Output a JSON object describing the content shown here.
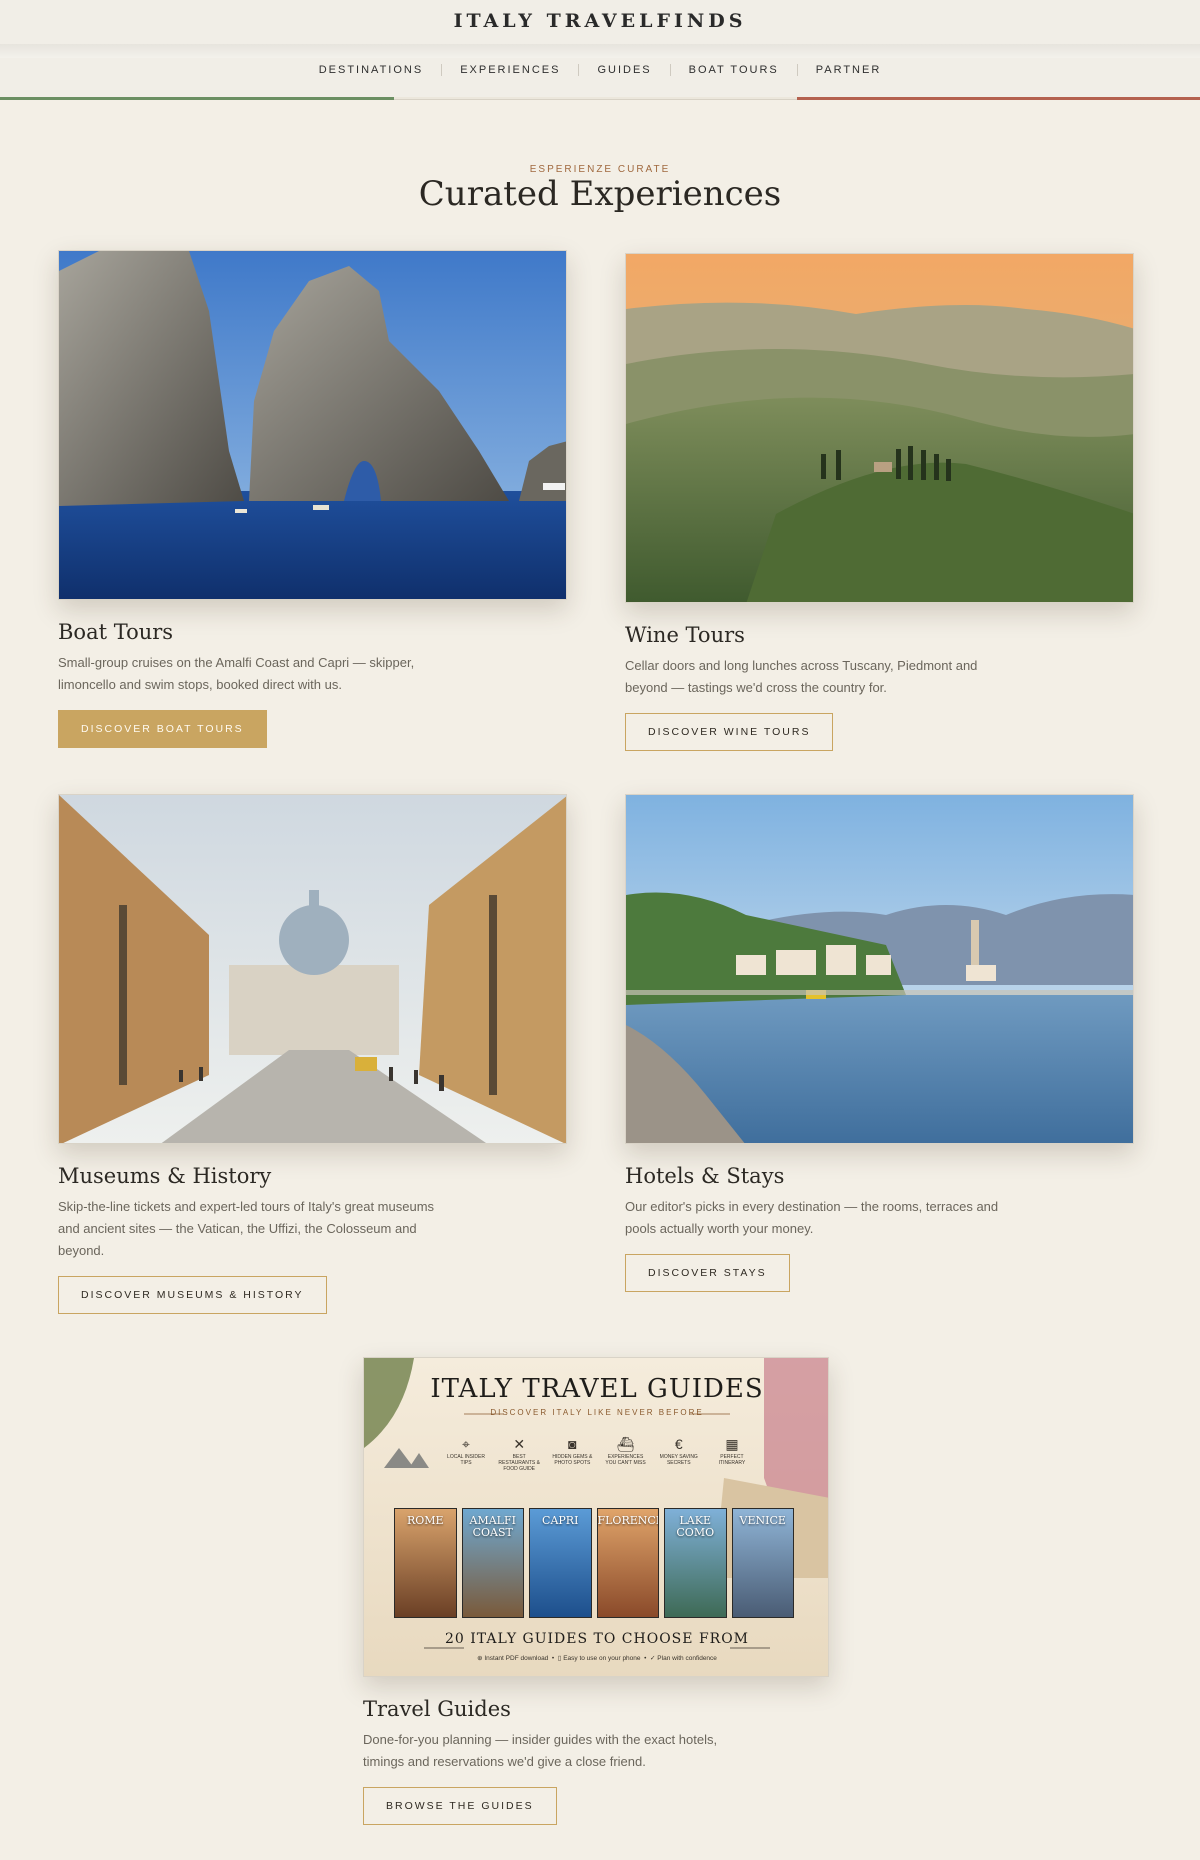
{
  "brand": "ITALY TRAVELFINDS",
  "nav": [
    "DESTINATIONS",
    "EXPERIENCES",
    "GUIDES",
    "BOAT TOURS",
    "PARTNER"
  ],
  "colors": {
    "accent_gold": "#c9a561",
    "flag_green": "#6b8f62",
    "flag_red": "#b4614f",
    "background": "#f3efe6"
  },
  "section": {
    "kicker": "ESPERIENZE CURATE",
    "title": "Curated Experiences"
  },
  "cards": [
    {
      "title": "Boat Tours",
      "desc": "Small-group cruises on the Amalfi Coast and Capri — skipper, limoncello and swim stops, booked direct with us.",
      "button": "DISCOVER BOAT TOURS"
    },
    {
      "title": "Wine Tours",
      "desc": "Cellar doors and long lunches across Tuscany, Piedmont and beyond — tastings we'd cross the country for.",
      "button": "DISCOVER WINE TOURS"
    },
    {
      "title": "Museums & History",
      "desc": "Skip-the-line tickets and expert-led tours of Italy's great museums and ancient sites — the Vatican, the Uffizi, the Colosseum and beyond.",
      "button": "DISCOVER MUSEUMS & HISTORY"
    },
    {
      "title": "Hotels & Stays",
      "desc": "Our editor's picks in every destination — the rooms, terraces and pools actually worth your money.",
      "button": "DISCOVER STAYS"
    },
    {
      "title": "Travel Guides",
      "desc": "Done-for-you planning — insider guides with the exact hotels, timings and reservations we'd give a close friend.",
      "button": "BROWSE THE GUIDES"
    }
  ],
  "guides_poster": {
    "title": "ITALY TRAVEL GUIDES",
    "subtitle": "DISCOVER ITALY LIKE NEVER BEFORE",
    "features": [
      {
        "icon": "pin-icon",
        "label": "LOCAL INSIDER TIPS"
      },
      {
        "icon": "cutlery-icon",
        "label": "BEST RESTAURANTS & FOOD GUIDE"
      },
      {
        "icon": "camera-icon",
        "label": "HIDDEN GEMS & PHOTO SPOTS"
      },
      {
        "icon": "boat-icon",
        "label": "EXPERIENCES YOU CAN'T MISS"
      },
      {
        "icon": "euro-icon",
        "label": "MONEY SAVING SECRETS"
      },
      {
        "icon": "calendar-icon",
        "label": "PERFECT ITINERARY"
      }
    ],
    "books": [
      "ROME",
      "AMALFI COAST",
      "CAPRI",
      "FLORENCE",
      "LAKE COMO",
      "VENICE"
    ],
    "choose": "20 ITALY GUIDES TO CHOOSE FROM",
    "footer": [
      "Instant PDF download",
      "Easy to use on your phone",
      "Plan with confidence"
    ]
  }
}
